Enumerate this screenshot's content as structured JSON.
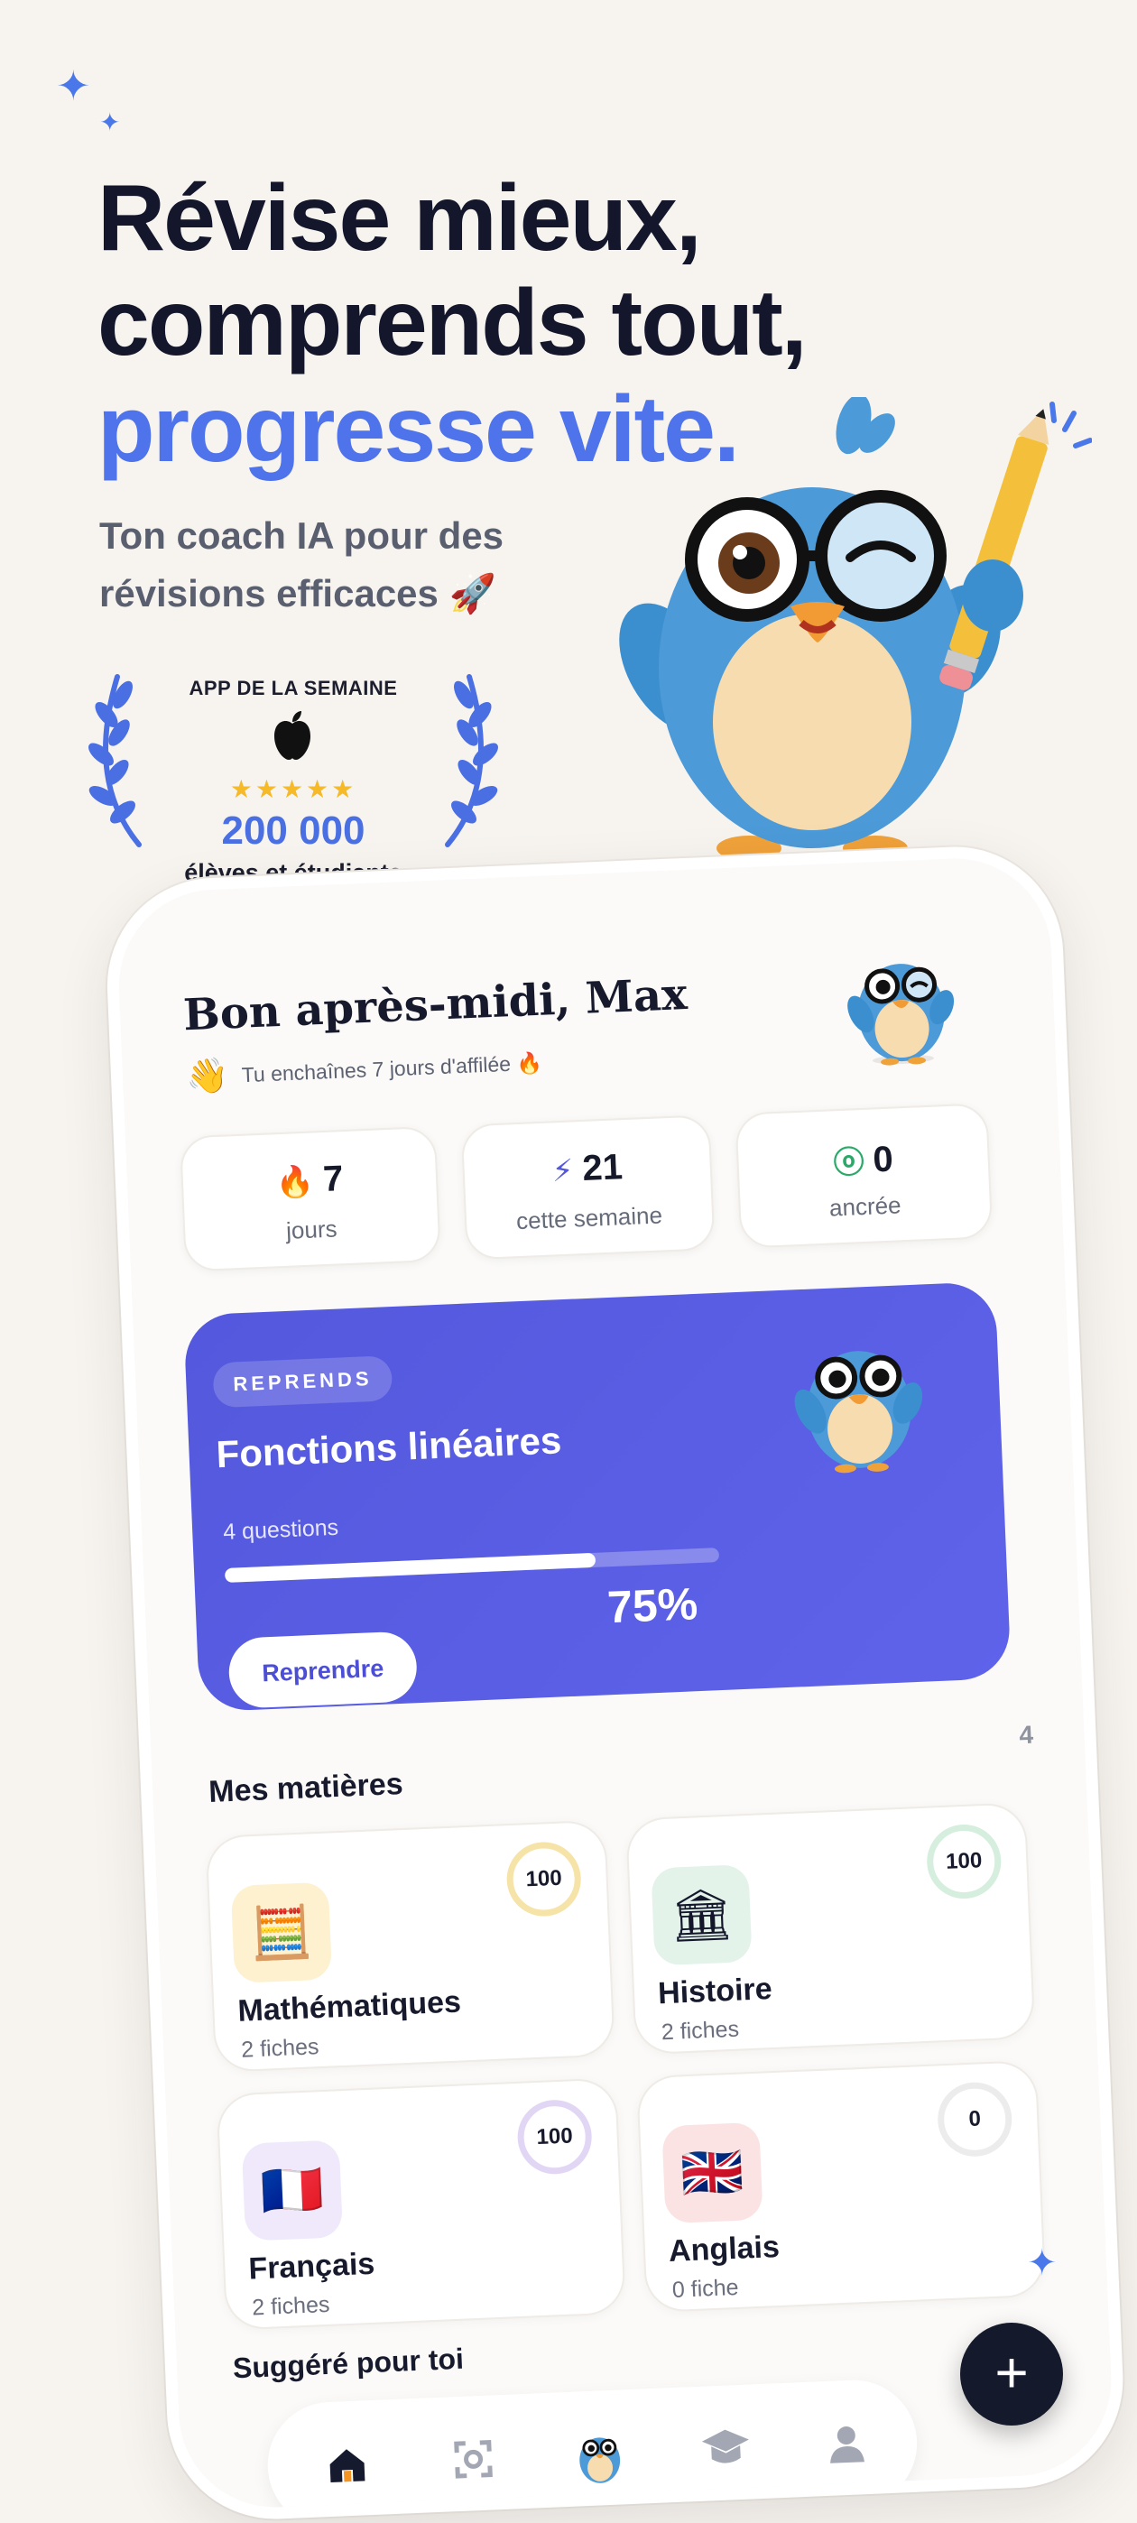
{
  "hero": {
    "line1": "Révise mieux,",
    "line2": "comprends tout,",
    "line3": "progresse vite.",
    "subtitle": "Ton coach IA pour des révisions efficaces 🚀"
  },
  "award": {
    "label": "APP DE LA SEMAINE",
    "rating_stars": 5,
    "stars_text": "★★★★★",
    "count": "200 000",
    "caption": "élèves et étudiants"
  },
  "app": {
    "greeting": "Bon après-midi, Max",
    "streak_emoji": "👋",
    "streak_text": "Tu enchaînes 7 jours d'affilée 🔥",
    "stats": [
      {
        "icon": "flame-icon",
        "value": "7",
        "label": "jours"
      },
      {
        "icon": "bolt-icon",
        "value": "21",
        "label": "cette semaine"
      },
      {
        "icon": "brain-icon",
        "value": "0",
        "label": "ancrée"
      }
    ],
    "resume": {
      "tag": "REPRENDS",
      "title": "Fonctions linéaires",
      "questions": "4 questions",
      "progress": 0.75,
      "percent_label": "75%",
      "button": "Reprendre"
    },
    "pager": "4",
    "subjects_title": "Mes matières",
    "subjects": [
      {
        "name": "Mathématiques",
        "count": "2 fiches",
        "score": "100",
        "icon": "calculator-icon",
        "tile": "#fdf1cf",
        "ring": "#f6e3a7"
      },
      {
        "name": "Histoire",
        "count": "2 fiches",
        "score": "100",
        "icon": "museum-icon",
        "tile": "#e3f3ea",
        "ring": "#d5eedd"
      },
      {
        "name": "Français",
        "count": "2 fiches",
        "score": "100",
        "icon": "french-flag-icon",
        "tile": "#efe9fb",
        "ring": "#e2d6f5"
      },
      {
        "name": "Anglais",
        "count": "0 fiche",
        "score": "0",
        "icon": "uk-flag-icon",
        "tile": "#fbe3e3",
        "ring": "#ececec"
      }
    ],
    "suggested_title": "Suggéré pour toi",
    "tabs": [
      {
        "name": "home",
        "icon": "home-icon"
      },
      {
        "name": "scan",
        "icon": "scan-icon"
      },
      {
        "name": "mascot",
        "icon": "mascot-icon"
      },
      {
        "name": "courses",
        "icon": "graduation-cap-icon"
      },
      {
        "name": "profile",
        "icon": "profile-icon"
      }
    ],
    "fab": "+"
  },
  "colors": {
    "accent_blue": "#4e73ea",
    "resume_card": "#5458dd",
    "fab": "#141a2c",
    "star_gold": "#f6b928"
  }
}
